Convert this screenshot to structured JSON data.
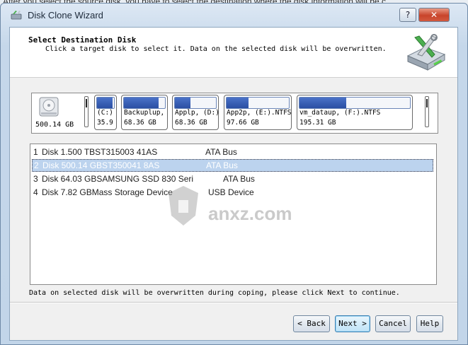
{
  "background_text": "After you select the source disk, you have to select the destination where the disk information will be c",
  "window": {
    "title": "Disk Clone Wizard",
    "help_glyph": "?",
    "close_glyph": "✕"
  },
  "header": {
    "title": "Select Destination Disk",
    "subtitle": "Click a target disk to select it. Data on the selected disk will be overwritten."
  },
  "disk_map": {
    "disk_size": "500.14 GB",
    "partitions": [
      {
        "name": "(C:)",
        "size": "35.9",
        "used_fraction": 0.92
      },
      {
        "name": "Backuplup,",
        "size": "68.36 GB",
        "used_fraction": 0.85
      },
      {
        "name": "Applp, (D:)",
        "size": "68.36 GB",
        "used_fraction": 0.38
      },
      {
        "name": "App2p, (E:).NTFS",
        "size": "97.66 GB",
        "used_fraction": 0.35
      },
      {
        "name": "vm_dataup, (F:).NTFS",
        "size": "195.31 GB",
        "used_fraction": 0.42
      }
    ]
  },
  "disk_list": [
    {
      "num": "1",
      "desc": "Disk 1.500 TBST315003 41AS",
      "bus": "ATA Bus",
      "selected": false
    },
    {
      "num": "2",
      "desc": "Disk 500.14 GBST350041 8AS",
      "bus": "ATA Bus",
      "selected": true
    },
    {
      "num": "3",
      "desc": "Disk 64.03 GBSAMSUNG  SSD 830 Seri",
      "bus": "ATA Bus",
      "selected": false
    },
    {
      "num": "4",
      "desc": "Disk 7.82 GBMass      Storage Device",
      "bus": "USB Device",
      "selected": false
    }
  ],
  "watermark": "anxz.com",
  "status": "Data on selected disk will be overwritten during coping, please click Next to continue.",
  "buttons": {
    "back": "< Back",
    "next": "Next >",
    "cancel": "Cancel",
    "help": "Help"
  },
  "colors": {
    "selection": "#bcd3ee",
    "partition_fill": "#2b4fa3",
    "close_button": "#c8442b"
  }
}
